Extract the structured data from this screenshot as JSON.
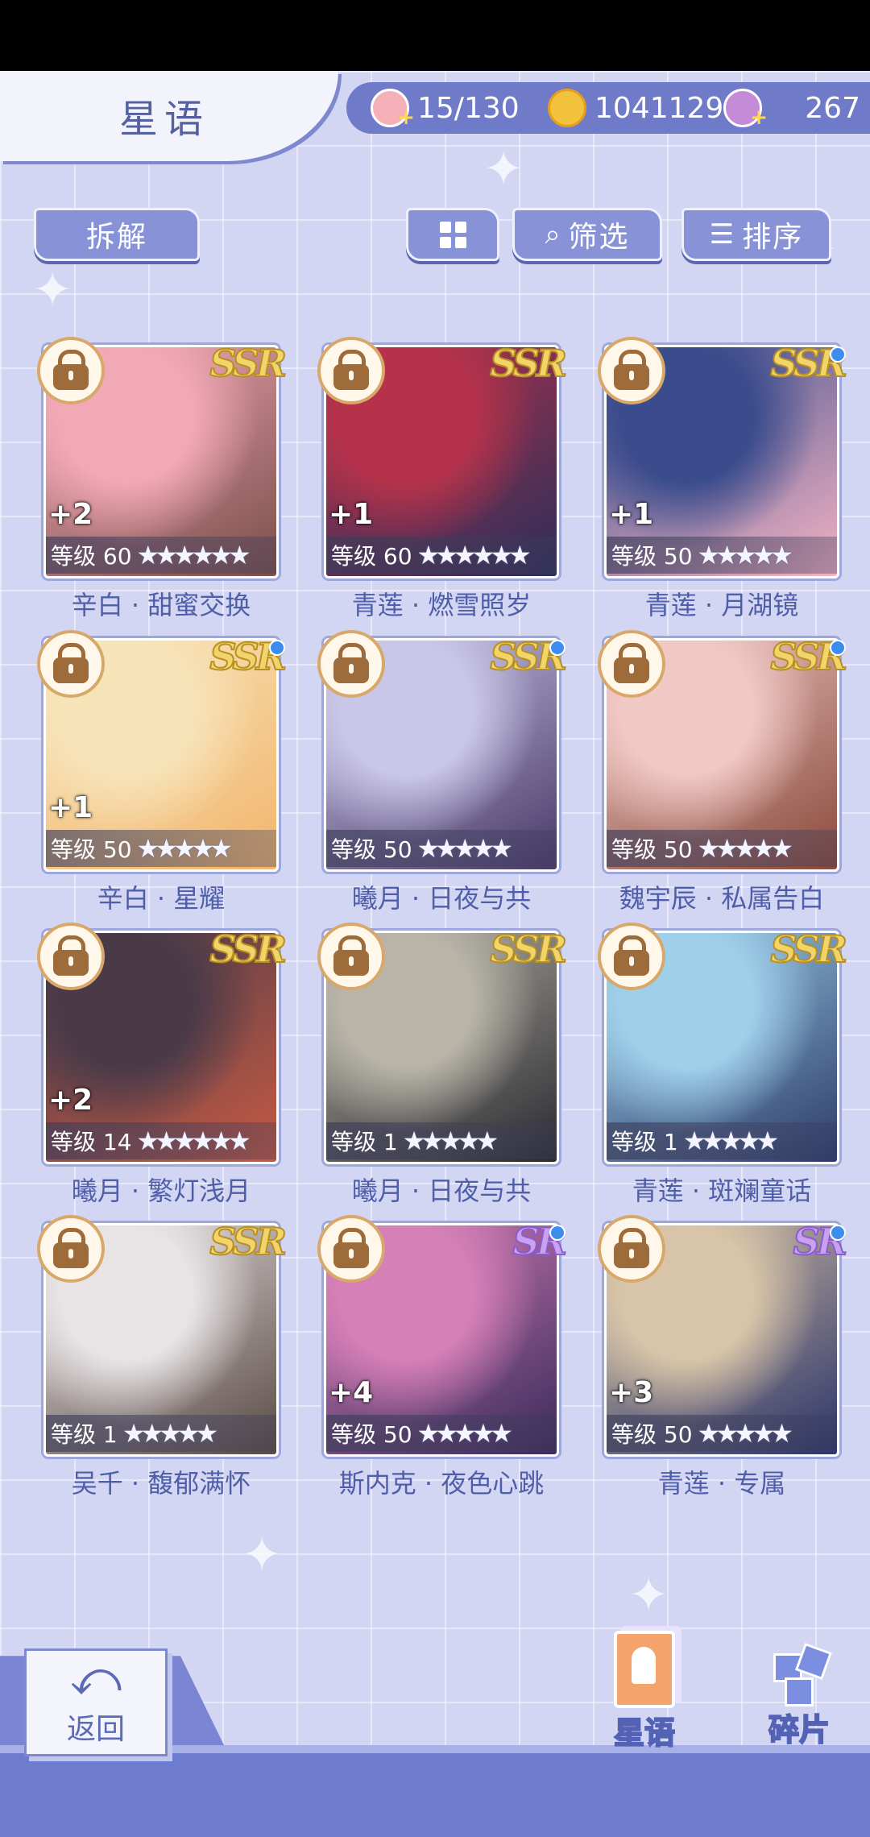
{
  "header": {
    "title": "星语"
  },
  "resources": [
    {
      "icon": "cake-icon",
      "value": "15/130"
    },
    {
      "icon": "coin-icon",
      "value": "1041129"
    },
    {
      "icon": "swan-icon",
      "value": "267"
    }
  ],
  "toolbar": {
    "dismantle_label": "拆解",
    "filter_label": "筛选",
    "sort_label": "排序"
  },
  "cards": [
    {
      "name": "辛白 · 甜蜜交换",
      "rarity": "SSR",
      "level": "等级 60",
      "stars": "★★★★★★",
      "plus": "+2",
      "new_dot": false,
      "art": [
        "#f2a9b6",
        "#7b4e4a"
      ]
    },
    {
      "name": "青莲 · 燃雪照岁",
      "rarity": "SSR",
      "level": "等级 60",
      "stars": "★★★★★★",
      "plus": "+1",
      "new_dot": false,
      "art": [
        "#b6324a",
        "#2c2e5a"
      ]
    },
    {
      "name": "青莲 · 月湖镜",
      "rarity": "SSR",
      "level": "等级 50",
      "stars": "★★★★★",
      "plus": "+1",
      "new_dot": true,
      "art": [
        "#3a4c8c",
        "#f3b3c3"
      ]
    },
    {
      "name": "辛白 · 星耀",
      "rarity": "SSR",
      "level": "等级 50",
      "stars": "★★★★★",
      "plus": "+1",
      "new_dot": true,
      "art": [
        "#f7e3b8",
        "#f2b66e"
      ]
    },
    {
      "name": "曦月 · 日夜与共",
      "rarity": "SSR",
      "level": "等级 50",
      "stars": "★★★★★",
      "plus": "",
      "new_dot": true,
      "art": [
        "#c9c6e8",
        "#4a3a68"
      ]
    },
    {
      "name": "魏宇辰 · 私属告白",
      "rarity": "SSR",
      "level": "等级 50",
      "stars": "★★★★★",
      "plus": "",
      "new_dot": true,
      "art": [
        "#f0c8c4",
        "#8a4a3c"
      ]
    },
    {
      "name": "曦月 · 繁灯浅月",
      "rarity": "SSR",
      "level": "等级 14",
      "stars": "★★★★★★",
      "plus": "+2",
      "new_dot": false,
      "art": [
        "#4a3a48",
        "#c55a44"
      ]
    },
    {
      "name": "曦月 · 日夜与共",
      "rarity": "SSR",
      "level": "等级 1",
      "stars": "★★★★★",
      "plus": "",
      "new_dot": false,
      "art": [
        "#b8b4a8",
        "#2a2a30"
      ]
    },
    {
      "name": "青莲 · 斑斓童话",
      "rarity": "SSR",
      "level": "等级 1",
      "stars": "★★★★★",
      "plus": "",
      "new_dot": false,
      "art": [
        "#9fd0ea",
        "#2c3c6a"
      ]
    },
    {
      "name": "吴千 · 馥郁满怀",
      "rarity": "SSR",
      "level": "等级 1",
      "stars": "★★★★★",
      "plus": "",
      "new_dot": false,
      "art": [
        "#e8e4e6",
        "#5a4a44"
      ]
    },
    {
      "name": "斯内克 · 夜色心跳",
      "rarity": "SR",
      "level": "等级 50",
      "stars": "★★★★★",
      "plus": "+4",
      "new_dot": true,
      "art": [
        "#d680b8",
        "#3a2a5a"
      ]
    },
    {
      "name": "青莲 · 专属",
      "rarity": "SR",
      "level": "等级 50",
      "stars": "★★★★★",
      "plus": "+3",
      "new_dot": true,
      "art": [
        "#d8c4a8",
        "#2c3468"
      ]
    }
  ],
  "footer": {
    "back_label": "返回",
    "nav_cards_label": "星语",
    "nav_fragments_label": "碎片"
  }
}
